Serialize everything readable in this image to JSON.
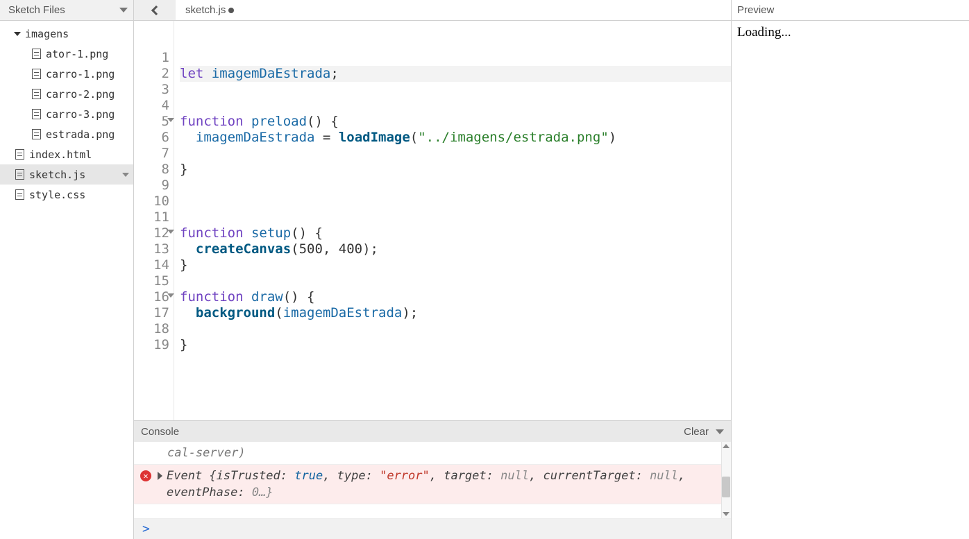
{
  "sidebar": {
    "title": "Sketch Files",
    "folder": {
      "name": "imagens",
      "expanded": true
    },
    "folder_files": [
      "ator-1.png",
      "carro-1.png",
      "carro-2.png",
      "carro-3.png",
      "estrada.png"
    ],
    "root_files": [
      {
        "name": "index.html",
        "selected": false
      },
      {
        "name": "sketch.js",
        "selected": true
      },
      {
        "name": "style.css",
        "selected": false
      }
    ]
  },
  "tab": {
    "name": "sketch.js",
    "dirty": true
  },
  "code": {
    "line_count": 19,
    "fold_lines": [
      5,
      12,
      16
    ],
    "highlight_line": 2,
    "tokens": {
      "let": "let",
      "function": "function",
      "imagemDaEstrada": "imagemDaEstrada",
      "preload": "preload",
      "setup": "setup",
      "draw": "draw",
      "loadImage": "loadImage",
      "createCanvas": "createCanvas",
      "background": "background",
      "str_path": "\"../imagens/estrada.png\"",
      "args_canvas": "(500, 400);"
    }
  },
  "console": {
    "title": "Console",
    "clear": "Clear",
    "prev_line": "cal-server)",
    "error": {
      "prefix": "Event ",
      "isTrusted_k": "{isTrusted: ",
      "isTrusted_v": "true",
      "type_k": ", type: ",
      "type_v": "\"error\"",
      "target_k": ", target: ",
      "target_v": "null",
      "ct_k": ", currentTarget: ",
      "ct_v": "null",
      "ep_k": ", eventPhase: ",
      "ep_v": "0…}"
    },
    "prompt": ">"
  },
  "preview": {
    "title": "Preview",
    "body": "Loading..."
  }
}
